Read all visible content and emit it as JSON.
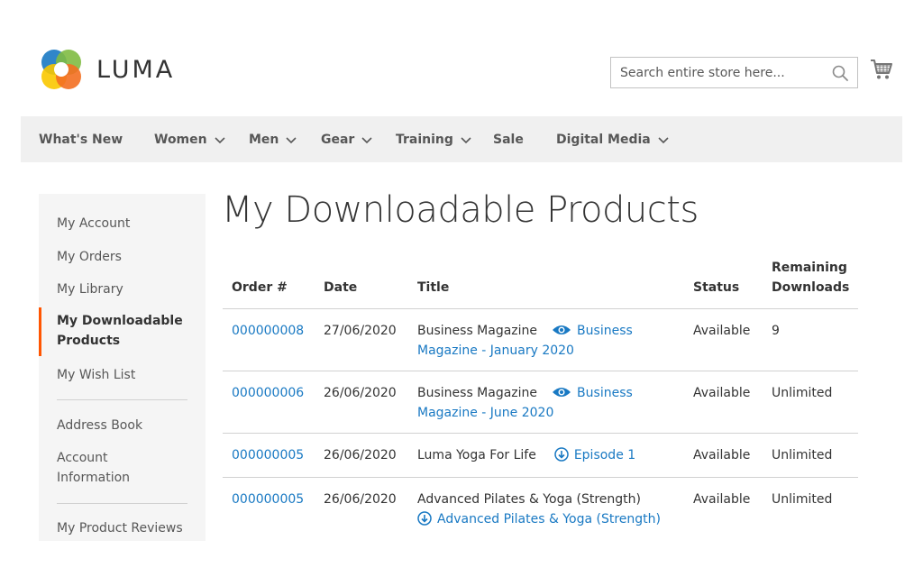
{
  "header": {
    "logo_text": "LUMA",
    "search": {
      "placeholder": "Search entire store here..."
    }
  },
  "nav": {
    "items": [
      {
        "label": "What's New",
        "has_dropdown": false
      },
      {
        "label": "Women",
        "has_dropdown": true
      },
      {
        "label": "Men",
        "has_dropdown": true
      },
      {
        "label": "Gear",
        "has_dropdown": true
      },
      {
        "label": "Training",
        "has_dropdown": true
      },
      {
        "label": "Sale",
        "has_dropdown": false
      },
      {
        "label": "Digital Media",
        "has_dropdown": true
      }
    ]
  },
  "sidebar": {
    "items": [
      {
        "label": "My Account"
      },
      {
        "label": "My Orders"
      },
      {
        "label": "My Library"
      },
      {
        "label": "My Downloadable Products",
        "active": true
      },
      {
        "label": "My Wish List"
      },
      {
        "label": "Address Book"
      },
      {
        "label": "Account Information"
      },
      {
        "label": "My Product Reviews"
      }
    ]
  },
  "page": {
    "title": "My Downloadable Products"
  },
  "table": {
    "headers": {
      "order": "Order #",
      "date": "Date",
      "title": "Title",
      "status": "Status",
      "remaining": "Remaining Downloads"
    },
    "rows": [
      {
        "order": "000000008",
        "date": "27/06/2020",
        "product": "Business Magazine",
        "link_icon": "eye-icon",
        "link": "Business Magazine - January 2020",
        "status": "Available",
        "remaining": "9"
      },
      {
        "order": "000000006",
        "date": "26/06/2020",
        "product": "Business Magazine",
        "link_icon": "eye-icon",
        "link": "Business Magazine - June 2020",
        "status": "Available",
        "remaining": "Unlimited"
      },
      {
        "order": "000000005",
        "date": "26/06/2020",
        "product": "Luma Yoga For Life",
        "link_icon": "download-icon",
        "link": "Episode 1",
        "status": "Available",
        "remaining": "Unlimited"
      },
      {
        "order": "000000005",
        "date": "26/06/2020",
        "product": "Advanced Pilates & Yoga (Strength)",
        "link_icon": "download-icon",
        "link": "Advanced Pilates & Yoga (Strength)",
        "status": "Available",
        "remaining": "Unlimited"
      }
    ]
  },
  "colors": {
    "link": "#1979c3",
    "active_marker": "#ff5501",
    "nav_bg": "#f0f0f0",
    "sidebar_bg": "#f5f5f5"
  }
}
